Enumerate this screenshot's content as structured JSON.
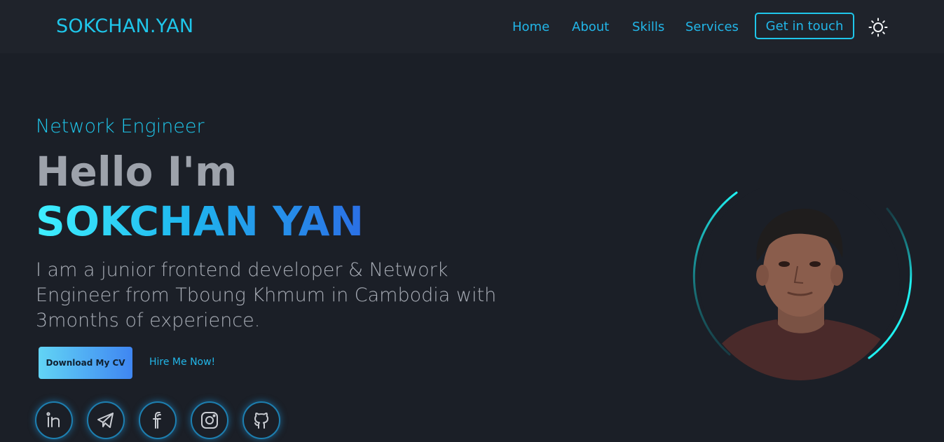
{
  "nav": {
    "logo": "SOKCHAN.YAN",
    "links": [
      "Home",
      "About",
      "Skills",
      "Services"
    ],
    "contact_label": "Get in touch",
    "theme_icon": "sun-icon"
  },
  "hero": {
    "role": "Network Engineer",
    "greeting": "Hello I'm",
    "name": "SOKCHAN YAN",
    "intro": "I am a junior frontend developer & Network Engineer from Tboung Khmum in Cambodia with 3months of experience.",
    "cv_button": "Download My CV",
    "hire_link": "Hire Me Now!"
  },
  "social": [
    "linkedin-icon",
    "telegram-icon",
    "facebook-icon",
    "instagram-icon",
    "github-icon"
  ],
  "colors": {
    "background": "#1b1f27",
    "navbar": "#1f232b",
    "accent": "#1fc6ea",
    "link": "#22b6e8",
    "ring": "#1ff0f0"
  }
}
